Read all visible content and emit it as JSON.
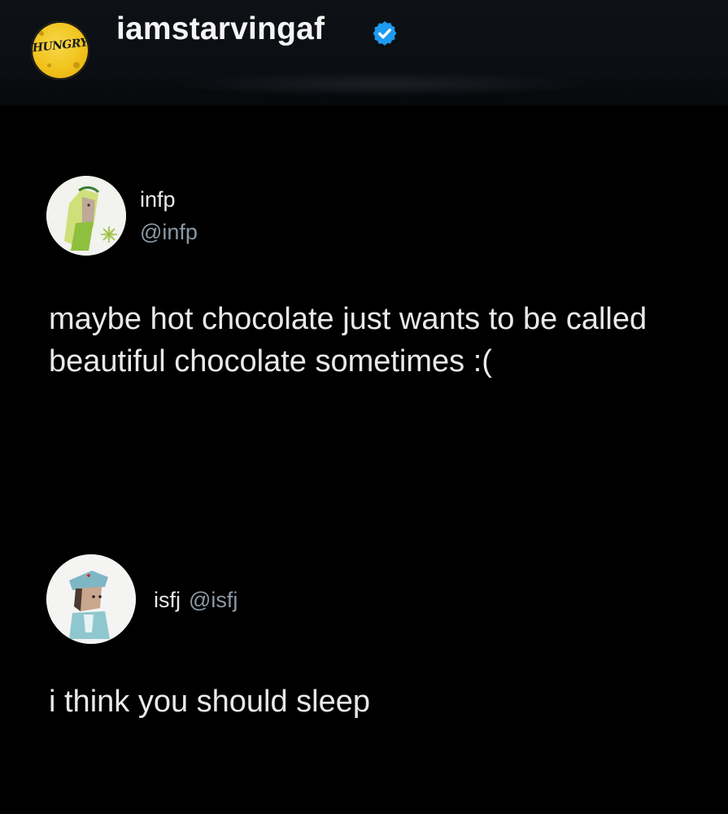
{
  "header": {
    "account_name": "iamstarvingaf",
    "logo_text": "HUNGRY",
    "logo_icon": "hungry-moon-logo",
    "verified_icon": "verified-badge-icon",
    "verified_color": "#1d9bf0"
  },
  "tweets": [
    {
      "name": "infp",
      "handle": "@infp",
      "text": "maybe hot chocolate just wants to be called beautiful chocolate sometimes :("
    },
    {
      "name": "isfj",
      "handle": "@isfj",
      "text": "i think you should sleep"
    }
  ],
  "colors": {
    "background": "#000000",
    "primary_text": "#e7e9ea",
    "secondary_text": "#8b98a5"
  }
}
